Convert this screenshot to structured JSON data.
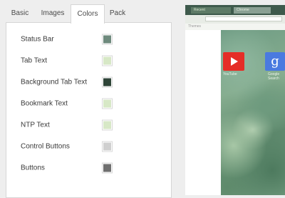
{
  "tabs": [
    {
      "label": "Basic"
    },
    {
      "label": "Images"
    },
    {
      "label": "Colors",
      "active": true
    },
    {
      "label": "Pack"
    }
  ],
  "colors": [
    {
      "label": "Status Bar",
      "color": "#6e8a7d"
    },
    {
      "label": "Tab Text",
      "color": "#d7e8c6"
    },
    {
      "label": "Background Tab Text",
      "color": "#2f4538"
    },
    {
      "label": "Bookmark Text",
      "color": "#d7e8c6"
    },
    {
      "label": "NTP Text",
      "color": "#d7e8c6"
    },
    {
      "label": "Control Buttons",
      "color": "#cfcfcf"
    },
    {
      "label": "Buttons",
      "color": "#6f6f6f"
    }
  ],
  "preview": {
    "tab1": "Recent",
    "tab2": "Chrome",
    "bookmark": "Themes",
    "apps": [
      {
        "label": "YouTube",
        "icon": "youtube-icon"
      },
      {
        "label": "Google Search",
        "glyph": "g",
        "icon": "google-icon"
      }
    ]
  }
}
